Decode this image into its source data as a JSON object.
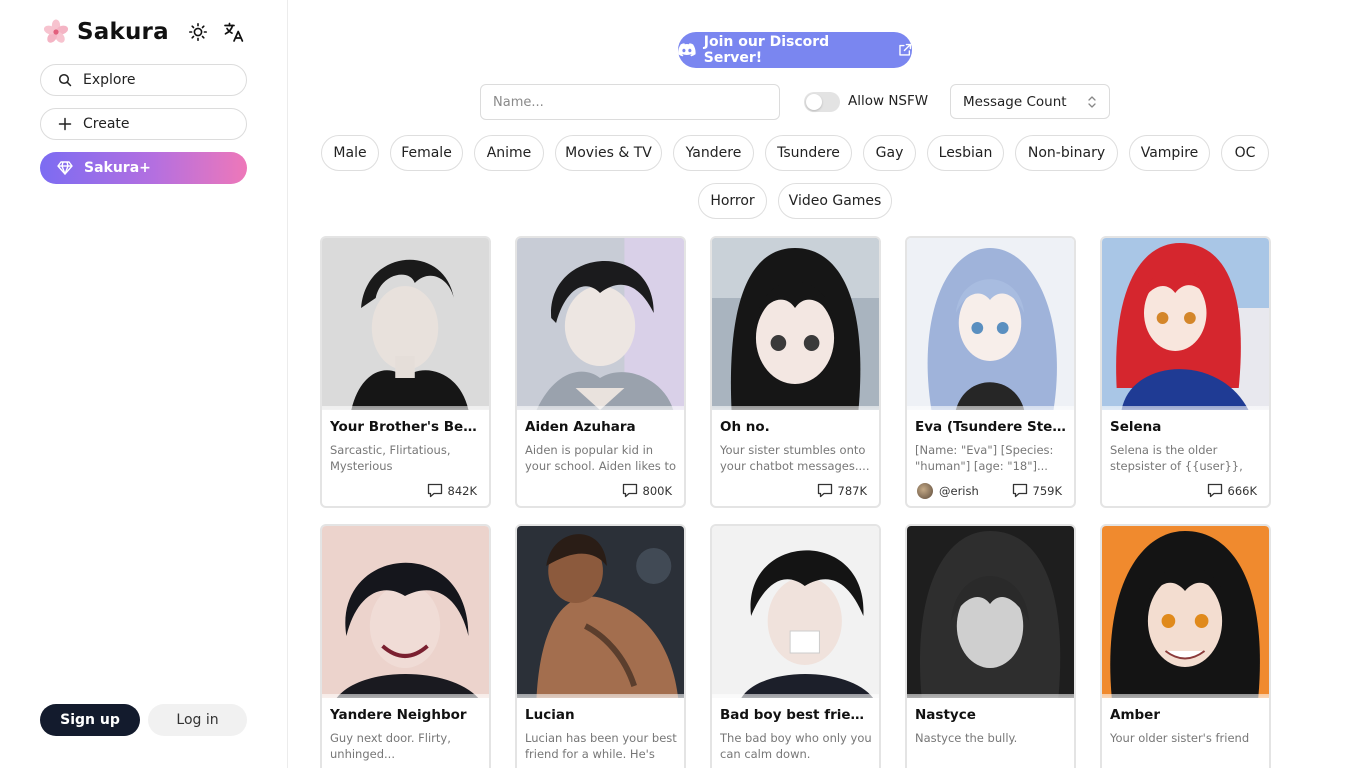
{
  "app": {
    "name": "Sakura"
  },
  "sidebar": {
    "explore_label": "Explore",
    "create_label": "Create",
    "plus_label": "Sakura+",
    "signup_label": "Sign up",
    "login_label": "Log in"
  },
  "toolbar": {
    "discord_label": "Join our Discord Server!",
    "name_placeholder": "Name...",
    "nsfw_label": "Allow NSFW",
    "nsfw_enabled": false,
    "sort_label": "Message Count"
  },
  "tags": [
    "Male",
    "Female",
    "Anime",
    "Movies & TV",
    "Yandere",
    "Tsundere",
    "Gay",
    "Lesbian",
    "Non-binary",
    "Vampire",
    "OC",
    "Horror",
    "Video Games"
  ],
  "cards": [
    {
      "title": "Your Brother's Best-...",
      "desc": "Sarcastic, Flirtatious, Mysterious",
      "count": "842K"
    },
    {
      "title": "Aiden Azuhara",
      "desc": "Aiden is popular kid in your school. Aiden likes to teas...",
      "count": "800K"
    },
    {
      "title": "Oh no.",
      "desc": "Your sister stumbles onto your chatbot messages....",
      "count": "787K"
    },
    {
      "title": "Eva (Tsundere Stepsi...",
      "desc": "[Name: \"Eva\"] [Species: \"human\"] [age: \"18\"]...",
      "count": "759K",
      "author": "@erish"
    },
    {
      "title": "Selena",
      "desc": "Selena is the older stepsister of {{user}}, she...",
      "count": "666K"
    },
    {
      "title": "Yandere Neighbor",
      "desc": "Guy next door. Flirty, unhinged...",
      "count": ""
    },
    {
      "title": "Lucian",
      "desc": "Lucian has been your best friend for a while. He's ver...",
      "count": ""
    },
    {
      "title": "Bad boy best friend |...",
      "desc": "The bad boy who only you can calm down.",
      "count": ""
    },
    {
      "title": "Nastyce",
      "desc": "Nastyce the bully.",
      "count": ""
    },
    {
      "title": "Amber",
      "desc": "Your older sister's friend",
      "count": ""
    }
  ],
  "colors": {
    "discord": "#7a86f0",
    "plus_gradient_start": "#7c6cf2",
    "plus_gradient_end": "#ee78b9",
    "signup_bg": "#131b2d"
  }
}
